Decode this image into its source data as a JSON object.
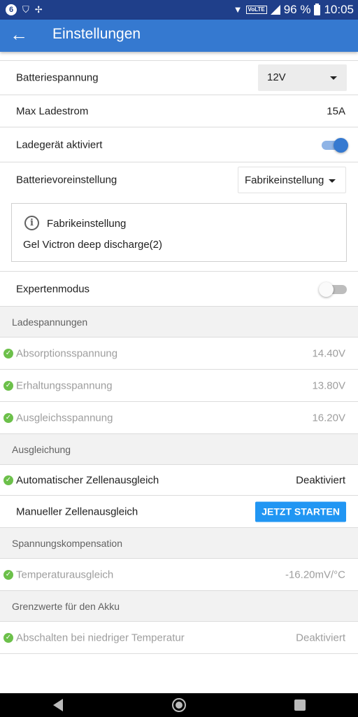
{
  "status_bar": {
    "notification_badge": "6",
    "network_label": "VoLTE",
    "battery_percent": "96 %",
    "time": "10:05"
  },
  "app_bar": {
    "title": "Einstellungen",
    "back_icon": "arrow-back-icon"
  },
  "settings": {
    "battery_voltage": {
      "label": "Batteriespannung",
      "value": "12V"
    },
    "max_current": {
      "label": "Max Ladestrom",
      "value": "15A"
    },
    "charger_enabled": {
      "label": "Ladegerät aktiviert",
      "enabled": true
    },
    "battery_preset": {
      "label": "Batterievoreinstellung",
      "value": "Fabrikeinstellung"
    },
    "preset_info": {
      "title": "Fabrikeinstellung",
      "text": "Gel Victron deep discharge(2)"
    },
    "expert_mode": {
      "label": "Expertenmodus",
      "enabled": false
    }
  },
  "sections": {
    "charge_voltages": {
      "title": "Ladespannungen",
      "items": [
        {
          "label": "Absorptionsspannung",
          "value": "14.40V"
        },
        {
          "label": "Erhaltungsspannung",
          "value": "13.80V"
        },
        {
          "label": "Ausgleichsspannung",
          "value": "16.20V"
        }
      ]
    },
    "equalization": {
      "title": "Ausgleichung",
      "auto": {
        "label": "Automatischer Zellenausgleich",
        "value": "Deaktiviert"
      },
      "manual": {
        "label": "Manueller Zellenausgleich",
        "button": "JETZT STARTEN"
      }
    },
    "voltage_compensation": {
      "title": "Spannungskompensation",
      "item": {
        "label": "Temperaturausgleich",
        "value": "-16.20mV/°C"
      }
    },
    "battery_limits": {
      "title": "Grenzwerte für den Akku",
      "item": {
        "label": "Abschalten bei niedriger Temperatur",
        "value": "Deaktiviert"
      }
    }
  },
  "colors": {
    "status_bar": "#1f3f8a",
    "app_bar": "#3579d0",
    "accent_button": "#2196f3",
    "check_green": "#6cc04a"
  }
}
